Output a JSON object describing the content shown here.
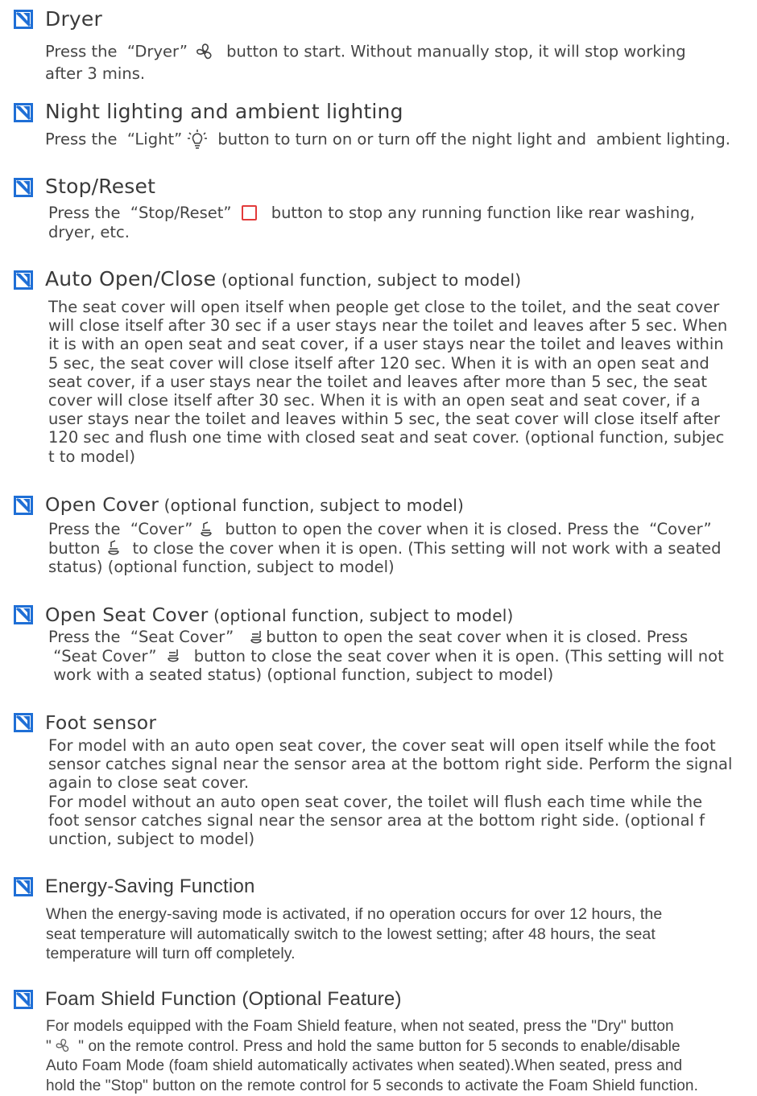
{
  "colors": {
    "accent": "#1f6fd6",
    "text": "#454545",
    "stop_icon": "#e23a3a"
  },
  "sections": [
    {
      "heading": "Dryer",
      "sub": "",
      "p1a": "Press the  “Dryer”",
      "p1b": " button to start. Without manually stop, it will stop working",
      "p2": "after 3 mins.",
      "icon": "fan-icon"
    },
    {
      "heading": "Night lighting and ambient lighting",
      "sub": "",
      "p1a": "Press the  “Light”",
      "p1b": " button to turn on or turn off the night light and  ambient lighting.",
      "icon": "light-bulb-icon"
    },
    {
      "heading": "Stop/Reset",
      "sub": "",
      "p1a": "Press the  “Stop/Reset”",
      "p1b": " button to stop any running function like rear washing,",
      "p2": "dryer, etc.",
      "icon": "stop-square-icon"
    },
    {
      "heading": "Auto Open/Close",
      "sub": " (optional function, subject to model)",
      "lines": [
        "The seat cover will open itself when people get close to the toilet, and the seat cover",
        "will close itself after 30 sec if a user stays near the toilet and leaves after 5 sec. When",
        "it is with an open seat and seat cover, if a user stays near the toilet and leaves within",
        "5 sec, the seat cover will close itself after 120 sec. When it is with an open seat and",
        "seat cover, if a user stays near the toilet and leaves after more than 5 sec, the seat",
        "cover will close itself after 30 sec. When it is with an open seat and seat cover, if a",
        "user stays near the toilet and leaves within 5 sec, the seat cover will close itself after",
        "120 sec and flush one time with closed seat and seat cover. (optional function, subjec",
        "t to model)"
      ]
    },
    {
      "heading": "Open Cover",
      "sub": " (optional function, subject to model)",
      "l1a": "Press the  “Cover”",
      "l1b": " button to open the cover when it is closed. Press the  “Cover”",
      "l2a": "button",
      "l2b": " to close the cover when it is open. (This setting will not work with a seated",
      "l3": "status) (optional function, subject to model)",
      "icon": "cover-icon"
    },
    {
      "heading": "Open Seat Cover",
      "sub": " (optional function, subject to model)",
      "l1a": "Press the  “Seat Cover”",
      "l1b": "button to open the seat cover when it is closed. Press",
      "l2a": " “Seat Cover”",
      "l2b": " button to close the seat cover when it is open. (This setting will not",
      "l3": " work with a seated status) (optional function, subject to model)",
      "icon": "seat-cover-icon"
    },
    {
      "heading": "Foot sensor",
      "sub": "",
      "lines": [
        "For model with an auto open seat cover, the cover seat will open itself while the foot",
        "sensor catches signal near the sensor area at the bottom right side. Perform the signal",
        "again to close seat cover.",
        "For model without an auto open seat cover, the toilet will flush each time while the",
        "foot sensor catches signal near the sensor area at the bottom right side. (optional f",
        "unction, subject to model)"
      ]
    },
    {
      "heading": "Energy-Saving Function",
      "sub": "",
      "lines": [
        "When the energy-saving mode is activated, if no operation occurs for over 12 hours, the",
        "seat temperature will automatically switch to the lowest setting; after 48 hours, the seat",
        "temperature will turn off completely."
      ]
    },
    {
      "heading": "Foam Shield Function (Optional Feature)",
      "sub": "",
      "l1": "For models equipped with the Foam Shield feature, when not seated, press the \"Dry\" button",
      "l2a": "\"",
      "l2b": " \" on the remote control. Press and hold the same button for 5 seconds to enable/disable",
      "l3": "Auto Foam Mode (foam shield automatically activates when seated).When seated, press and",
      "l4": "hold the \"Stop\" button on the remote control for 5 seconds to activate the Foam Shield function.",
      "icon": "fan-icon"
    }
  ]
}
